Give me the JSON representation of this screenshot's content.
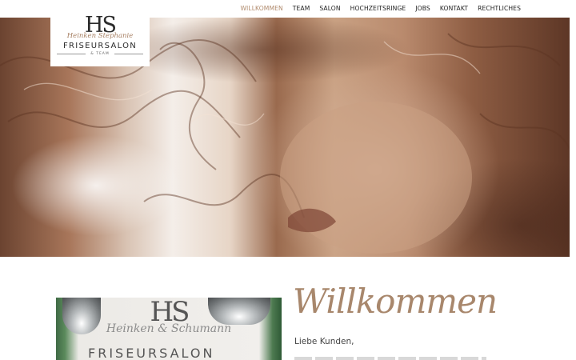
{
  "nav": {
    "items": [
      {
        "label": "WILLKOMMEN",
        "active": true
      },
      {
        "label": "TEAM",
        "active": false
      },
      {
        "label": "SALON",
        "active": false
      },
      {
        "label": "HOCHZEITSRINGE",
        "active": false
      },
      {
        "label": "JOBS",
        "active": false
      },
      {
        "label": "KONTAKT",
        "active": false
      },
      {
        "label": "RECHTLICHES",
        "active": false
      }
    ]
  },
  "logo": {
    "monogram": "HS",
    "script": "Heinken Stephanie",
    "main": "FRISEURSALON",
    "sub": "& TEAM"
  },
  "intro": {
    "heading": "Willkommen",
    "greeting": "Liebe Kunden,"
  },
  "photo": {
    "monogram": "HS",
    "script": "Heinken & Schumann",
    "main": "FRISEURSALON"
  },
  "colors": {
    "accent": "#b08a6c",
    "heading": "#a8876c",
    "text": "#222222"
  }
}
